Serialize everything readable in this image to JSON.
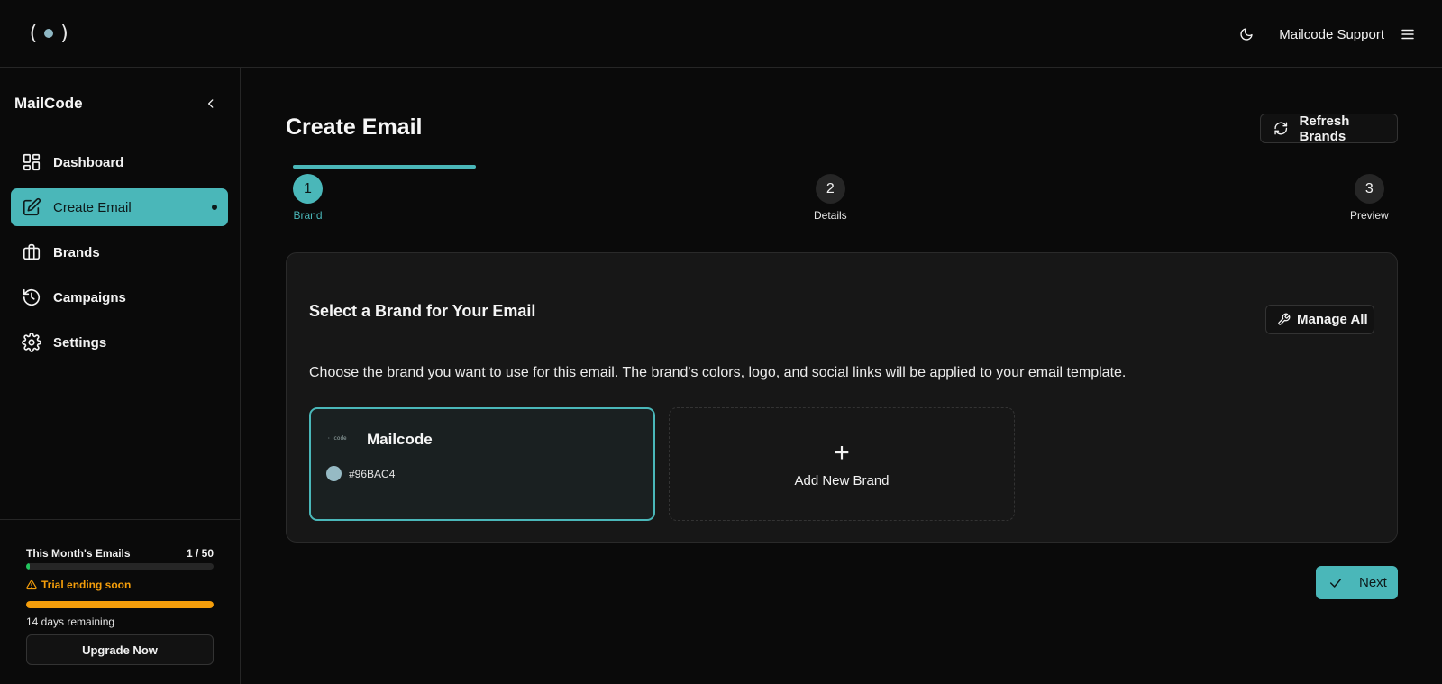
{
  "app": {
    "logo_text_left": "(",
    "logo_text_right": ")",
    "support_label": "Mailcode Support"
  },
  "sidebar": {
    "title": "MailCode",
    "items": [
      {
        "label": "Dashboard",
        "icon": "dashboard-icon"
      },
      {
        "label": "Create Email",
        "icon": "edit-icon",
        "active": true
      },
      {
        "label": "Brands",
        "icon": "briefcase-icon"
      },
      {
        "label": "Campaigns",
        "icon": "history-icon"
      },
      {
        "label": "Settings",
        "icon": "gear-icon"
      }
    ],
    "usage": {
      "label": "This Month's Emails",
      "count": "1 / 50",
      "progress": 0.02,
      "trial_label": "Trial ending soon",
      "trial_progress": 1.0,
      "days_remaining": "14 days remaining",
      "upgrade_label": "Upgrade Now"
    }
  },
  "main": {
    "title": "Create Email",
    "refresh_label": "Refresh Brands",
    "steps": [
      {
        "number": "1",
        "label": "Brand",
        "active": true
      },
      {
        "number": "2",
        "label": "Details"
      },
      {
        "number": "3",
        "label": "Preview"
      }
    ],
    "card": {
      "title": "Select a Brand for Your Email",
      "manage_label": "Manage All",
      "description": "Choose the brand you want to use for this email. The brand's colors, logo, and social links will be applied to your email template.",
      "brands": [
        {
          "name": "Mailcode",
          "logo_text": "·   code",
          "color": "#96BAC4",
          "color_label": "#96BAC4",
          "selected": true
        }
      ],
      "add_label": "Add New Brand",
      "add_symbol": "+"
    },
    "next_label": "Next"
  },
  "colors": {
    "accent": "#4ab7b9",
    "warning": "#f59e0b",
    "success": "#22c55e",
    "background": "#0a0a0a",
    "card": "#171717"
  }
}
